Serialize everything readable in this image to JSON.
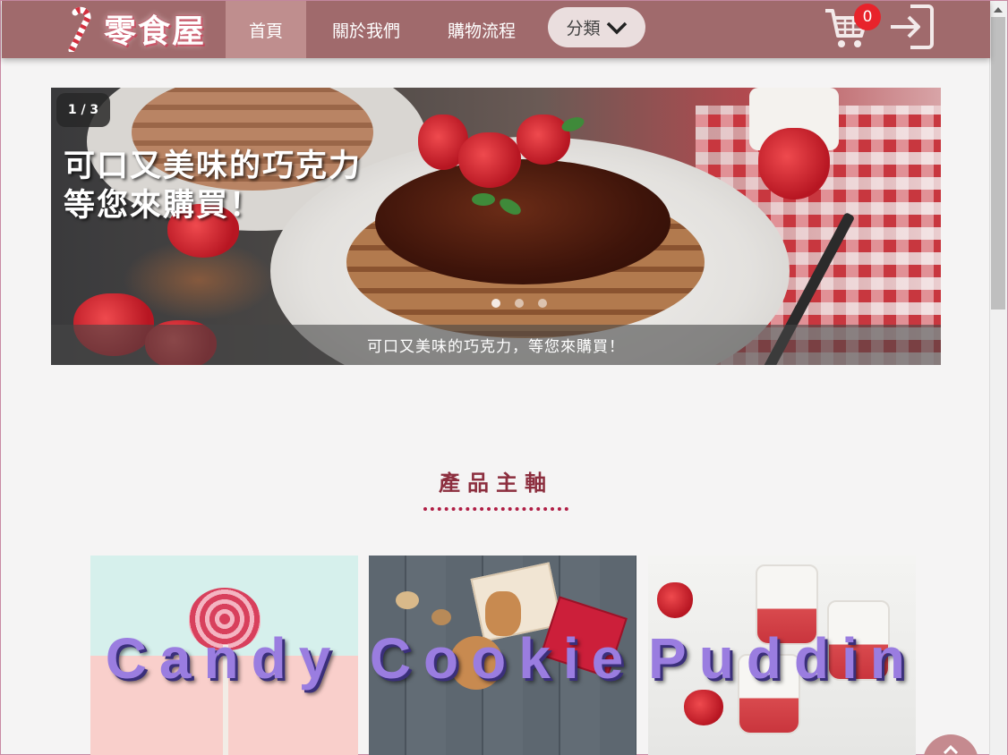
{
  "nav": {
    "logo_text": "零食屋",
    "items": [
      {
        "label": "首頁",
        "active": true
      },
      {
        "label": "關於我們"
      },
      {
        "label": "購物流程"
      }
    ],
    "category_label": "分類",
    "cart_count": "0"
  },
  "carousel": {
    "counter": "1 / 3",
    "headline_line1": "可口又美味的巧克力",
    "headline_line2": "等您來購買！",
    "caption": "可口又美味的巧克力，等您來購買！",
    "slide_count": 3,
    "active_slide": 1
  },
  "section": {
    "title": "產品主軸"
  },
  "products": [
    {
      "label": "Candy"
    },
    {
      "label": "Cookie"
    },
    {
      "label": "Pudding"
    }
  ],
  "colors": {
    "navbar": "#a06a6c",
    "nav_active": "#bf8e8e",
    "accent": "#8c2e3e",
    "badge": "#e8232b",
    "product_label": "#9a7de0"
  },
  "icons": {
    "logo": "candy-cane-icon",
    "category": "chevron-down-icon",
    "cart": "cart-icon",
    "login": "login-icon",
    "back_to_top": "chevron-up-icon"
  }
}
